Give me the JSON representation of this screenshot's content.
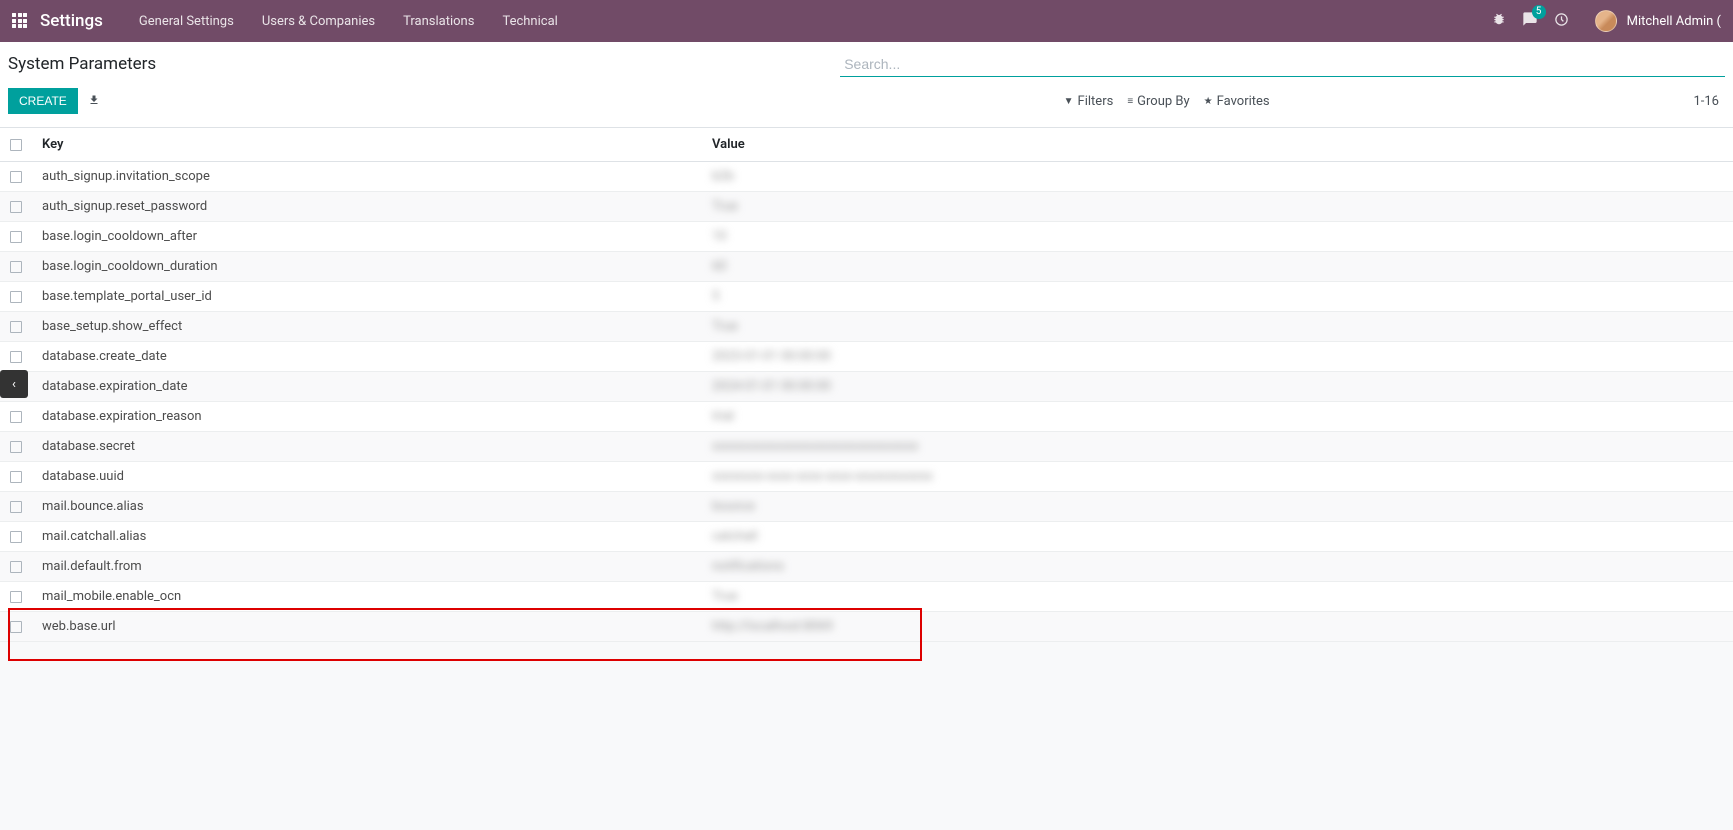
{
  "nav": {
    "brand": "Settings",
    "items": [
      "General Settings",
      "Users & Companies",
      "Translations",
      "Technical"
    ],
    "msg_count": "5",
    "user": "Mitchell Admin ("
  },
  "cp": {
    "breadcrumb": "System Parameters",
    "search_placeholder": "Search...",
    "create": "CREATE",
    "filters": "Filters",
    "groupby": "Group By",
    "favorites": "Favorites",
    "pager": "1-16"
  },
  "table": {
    "headers": {
      "key": "Key",
      "value": "Value"
    },
    "rows": [
      {
        "key": "auth_signup.invitation_scope",
        "value": "b2b"
      },
      {
        "key": "auth_signup.reset_password",
        "value": "True"
      },
      {
        "key": "base.login_cooldown_after",
        "value": "10"
      },
      {
        "key": "base.login_cooldown_duration",
        "value": "60"
      },
      {
        "key": "base.template_portal_user_id",
        "value": "5"
      },
      {
        "key": "base_setup.show_effect",
        "value": "True"
      },
      {
        "key": "database.create_date",
        "value": "2023-01-01 00:00:00"
      },
      {
        "key": "database.expiration_date",
        "value": "2024-01-01 00:00:00"
      },
      {
        "key": "database.expiration_reason",
        "value": "trial"
      },
      {
        "key": "database.secret",
        "value": "xxxxxxxxxxxxxxxxxxxxxxxxxxxxxxxx"
      },
      {
        "key": "database.uuid",
        "value": "xxxxxxxx-xxxx-xxxx-xxxx-xxxxxxxxxxxx"
      },
      {
        "key": "mail.bounce.alias",
        "value": "bounce"
      },
      {
        "key": "mail.catchall.alias",
        "value": "catchall"
      },
      {
        "key": "mail.default.from",
        "value": "notifications"
      },
      {
        "key": "mail_mobile.enable_ocn",
        "value": "True"
      },
      {
        "key": "web.base.url",
        "value": "http://localhost:8069"
      }
    ]
  },
  "side_handle": "‹"
}
